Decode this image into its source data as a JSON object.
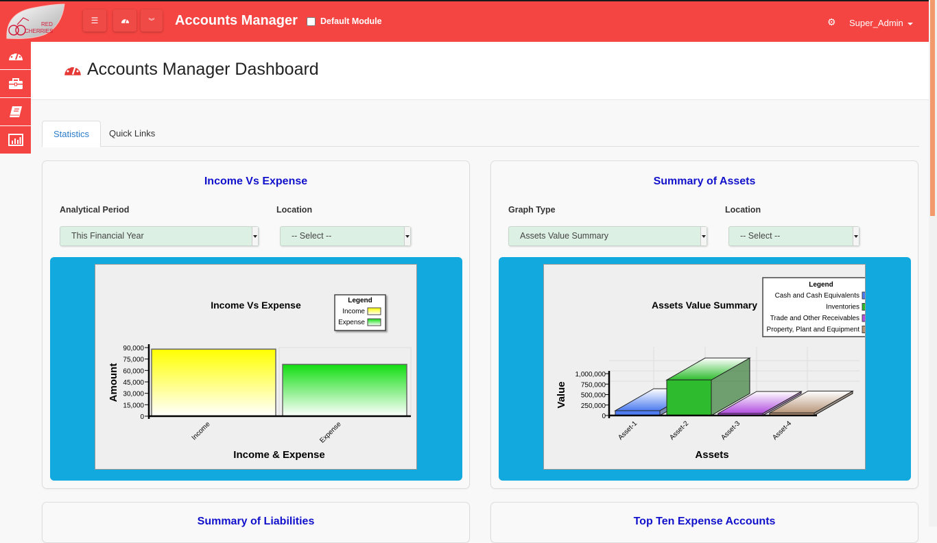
{
  "topbar": {
    "logo_text": [
      "RED",
      "CHERRIES"
    ],
    "menu_icon": "hamburger-icon",
    "dashboard_icon": "tachometer-icon",
    "dropdown_icon": "chevron-double-down-icon",
    "app_title": "Accounts Manager",
    "default_module_label": "Default Module",
    "default_module_checked": false,
    "settings_icon": "gear-icon",
    "user_name": "Super_Admin"
  },
  "sidebar": {
    "items": [
      {
        "icon": "tachometer-icon",
        "name": "dashboard"
      },
      {
        "icon": "briefcase-icon",
        "name": "business"
      },
      {
        "icon": "book-icon",
        "name": "ledger"
      },
      {
        "icon": "bar-chart-icon",
        "name": "reports"
      }
    ]
  },
  "page": {
    "title": "Accounts Manager Dashboard",
    "accent": "#f44542"
  },
  "tabs": [
    {
      "label": "Statistics",
      "active": true
    },
    {
      "label": "Quick Links",
      "active": false
    }
  ],
  "panels": {
    "income_expense": {
      "title": "Income Vs Expense",
      "filter1_label": "Analytical Period",
      "filter1_value": "This Financial Year",
      "filter2_label": "Location",
      "filter2_value": "-- Select --"
    },
    "assets": {
      "title": "Summary of Assets",
      "filter1_label": "Graph Type",
      "filter1_value": "Assets Value Summary",
      "filter2_label": "Location",
      "filter2_value": "-- Select --"
    },
    "liabilities": {
      "title": "Summary of Liabilities"
    },
    "top_expense": {
      "title": "Top Ten Expense Accounts"
    }
  },
  "chart_data": [
    {
      "type": "bar",
      "title": "Income Vs Expense",
      "xlabel": "Income & Expense",
      "ylabel": "Amount",
      "categories": [
        "Income",
        "Expense"
      ],
      "values": [
        88000,
        68000
      ],
      "colors": [
        "#ffff00",
        "#11dd11"
      ],
      "ylim": [
        0,
        90000
      ],
      "yticks": [
        "0",
        "15,000",
        "30,000",
        "45,000",
        "60,000",
        "75,000",
        "90,000"
      ],
      "ytick_values": [
        0,
        15000,
        30000,
        45000,
        60000,
        75000,
        90000
      ],
      "legend": {
        "title": "Legend",
        "entries": [
          "Income",
          "Expense"
        ],
        "placement": "top-right"
      },
      "grid": true
    },
    {
      "type": "bar",
      "title": "Assets Value Summary",
      "xlabel": "Assets",
      "ylabel": "Value",
      "categories": [
        "Asset-1",
        "Asset-2",
        "Asset-3",
        "Asset-4"
      ],
      "values": [
        115000,
        850000,
        20000,
        60000
      ],
      "colors": [
        "#4d7cf0",
        "#2ebc2e",
        "#b14fe0",
        "#b8967a"
      ],
      "ylim": [
        0,
        1000000
      ],
      "yticks": [
        "0",
        "250,000",
        "500,000",
        "750,000",
        "1,000,000"
      ],
      "ytick_values": [
        0,
        250000,
        500000,
        750000,
        1000000
      ],
      "legend": {
        "title": "Legend",
        "entries": [
          "Cash and Cash Equivalents",
          "Inventories",
          "Trade and Other Receivables",
          "Property, Plant and Equipment"
        ],
        "placement": "top-right"
      },
      "grid": true,
      "style": "3d"
    }
  ]
}
